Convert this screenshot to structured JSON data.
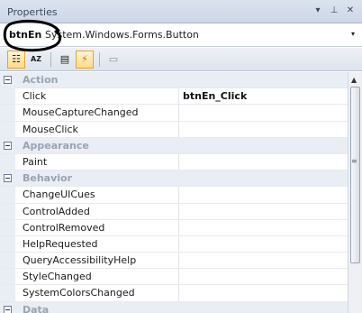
{
  "window": {
    "title": "Properties",
    "pin_glyph": "▾",
    "autohide_glyph": "⊥",
    "close_glyph": "✕"
  },
  "object_selector": {
    "name": "btnEn",
    "type": "System.Windows.Forms.Button",
    "dropdown_glyph": "▾"
  },
  "toolbar": {
    "categorized_glyph": "☷",
    "alphabetical_glyph": "AZ",
    "properties_glyph": "▤",
    "events_glyph": "⚡",
    "pages_glyph": "▭"
  },
  "grid": {
    "categories": [
      {
        "label": "Action",
        "items": [
          {
            "name": "Click",
            "value": "btnEn_Click"
          },
          {
            "name": "MouseCaptureChanged",
            "value": ""
          },
          {
            "name": "MouseClick",
            "value": ""
          }
        ]
      },
      {
        "label": "Appearance",
        "items": [
          {
            "name": "Paint",
            "value": ""
          }
        ]
      },
      {
        "label": "Behavior",
        "items": [
          {
            "name": "ChangeUICues",
            "value": ""
          },
          {
            "name": "ControlAdded",
            "value": ""
          },
          {
            "name": "ControlRemoved",
            "value": ""
          },
          {
            "name": "HelpRequested",
            "value": ""
          },
          {
            "name": "QueryAccessibilityHelp",
            "value": ""
          },
          {
            "name": "StyleChanged",
            "value": ""
          },
          {
            "name": "SystemColorsChanged",
            "value": ""
          }
        ]
      },
      {
        "label": "Data",
        "items": []
      }
    ]
  },
  "scrollbar": {
    "up_glyph": "▲",
    "grip_glyph": "≡"
  },
  "colors": {
    "accent_active": "#ffd98a",
    "category_background": "#e9edf4",
    "annotation_ink": "#000000"
  }
}
